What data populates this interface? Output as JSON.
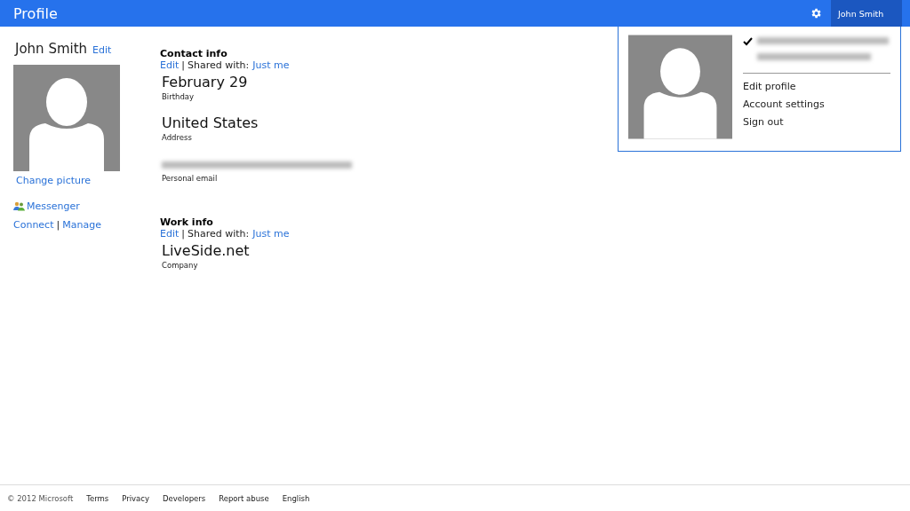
{
  "header": {
    "title": "Profile",
    "user_button": "John Smith"
  },
  "profile": {
    "name": "John Smith",
    "edit": "Edit",
    "change_picture": "Change picture",
    "messenger": "Messenger",
    "connect": "Connect",
    "separator": "|",
    "manage": "Manage"
  },
  "sections": [
    {
      "title": "Contact info",
      "edit": "Edit",
      "separator": "|",
      "shared_label": "Shared with:",
      "shared_value": "Just me",
      "fields": [
        {
          "kind": "text",
          "value": "February 29",
          "label": "Birthday"
        },
        {
          "kind": "text",
          "value": "United States",
          "label": "Address"
        },
        {
          "kind": "redacted",
          "label": "Personal email"
        }
      ]
    },
    {
      "title": "Work info",
      "edit": "Edit",
      "separator": "|",
      "shared_label": "Shared with:",
      "shared_value": "Just me",
      "fields": [
        {
          "kind": "text",
          "value": "LiveSide.net",
          "label": "Company"
        }
      ]
    }
  ],
  "account_menu": {
    "account_checked": true,
    "items": [
      "Edit profile",
      "Account settings",
      "Sign out"
    ]
  },
  "footer": {
    "copyright": "© 2012 Microsoft",
    "links": [
      "Terms",
      "Privacy",
      "Developers",
      "Report abuse",
      "English"
    ]
  }
}
